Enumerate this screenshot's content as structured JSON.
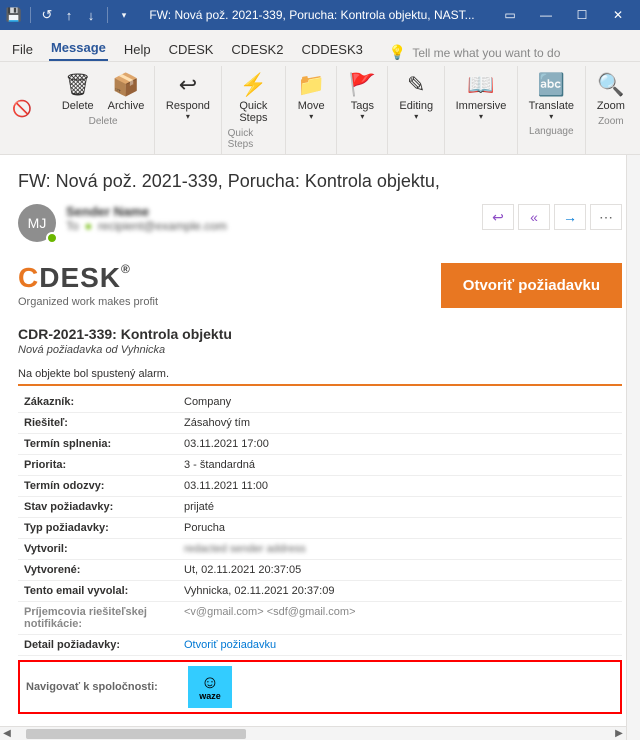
{
  "titlebar": {
    "title": "FW: Nová pož. 2021-339, Porucha: Kontrola objektu, NAST..."
  },
  "tabs": {
    "file": "File",
    "message": "Message",
    "help": "Help",
    "cdesk": "CDESK",
    "cdesk2": "CDESK2",
    "cddesk3": "CDDESK3",
    "tellme": "Tell me what you want to do"
  },
  "ribbon": {
    "delete": "Delete",
    "archive": "Archive",
    "respond": "Respond",
    "quicksteps": "Quick\nSteps",
    "move": "Move",
    "tags": "Tags",
    "editing": "Editing",
    "immersive": "Immersive",
    "translate": "Translate",
    "zoom": "Zoom",
    "grp_delete": "Delete",
    "grp_quicksteps": "Quick Steps",
    "grp_language": "Language",
    "grp_zoom": "Zoom"
  },
  "message": {
    "subject": "FW: Nová pož. 2021-339, Porucha: Kontrola objektu,",
    "avatar_initials": "MJ",
    "from": "Sender Name",
    "to_label": "To",
    "to_value": "recipient@example.com"
  },
  "brand": {
    "name_c": "C",
    "name_desk": "DESK",
    "registered": "®",
    "tagline": "Organized work makes profit",
    "open_button": "Otvoriť požiadavku"
  },
  "request": {
    "title": "CDR-2021-339: Kontrola objektu",
    "subtitle": "Nová požiadavka od Vyhnicka",
    "alarm": "Na objekte bol spustený alarm."
  },
  "rows": {
    "customer_label": "Zákazník:",
    "customer_value": "Company",
    "solver_label": "Riešiteľ:",
    "solver_value": "Zásahový tím",
    "deadline_label": "Termín splnenia:",
    "deadline_value": "03.11.2021 17:00",
    "priority_label": "Priorita:",
    "priority_value": "3 - štandardná",
    "response_label": "Termín odozvy:",
    "response_value": "03.11.2021 11:00",
    "state_label": "Stav požiadavky:",
    "state_value": "prijaté",
    "type_label": "Typ požiadavky:",
    "type_value": "Porucha",
    "createdby_label": "Vytvoril:",
    "createdby_value": "redacted sender address",
    "created_label": "Vytvorené:",
    "created_value": "Ut, 02.11.2021 20:37:05",
    "triggered_label": "Tento email vyvolal:",
    "triggered_value": "Vyhnicka, 02.11.2021 20:37:09",
    "recipients_label": "Príjemcovia riešiteľskej notifikácie:",
    "recipients_value": "<v@gmail.com> <sdf@gmail.com>",
    "detail_label": "Detail požiadavky:",
    "detail_link": "Otvoriť požiadavku",
    "nav_label": "Navigovať k spoločnosti:",
    "waze_text": "waze"
  }
}
